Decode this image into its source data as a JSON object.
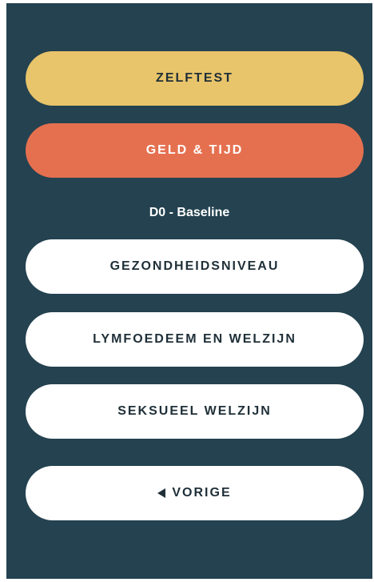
{
  "buttons": {
    "zelftest": "ZELFTEST",
    "geld_tijd": "GELD & TIJD",
    "gezondheidsniveau": "GEZONDHEIDSNIVEAU",
    "lymfoedeem": "LYMFOEDEEM EN WELZIJN",
    "seksueel": "SEKSUEEL WELZIJN",
    "vorige": "VORIGE"
  },
  "section": {
    "label": "D0 - Baseline"
  },
  "icons": {
    "back": "left-triangle-icon"
  },
  "colors": {
    "background": "#244250",
    "zelftest": "#e8c46a",
    "geld_tijd": "#e5704f",
    "white_button": "#ffffff"
  }
}
